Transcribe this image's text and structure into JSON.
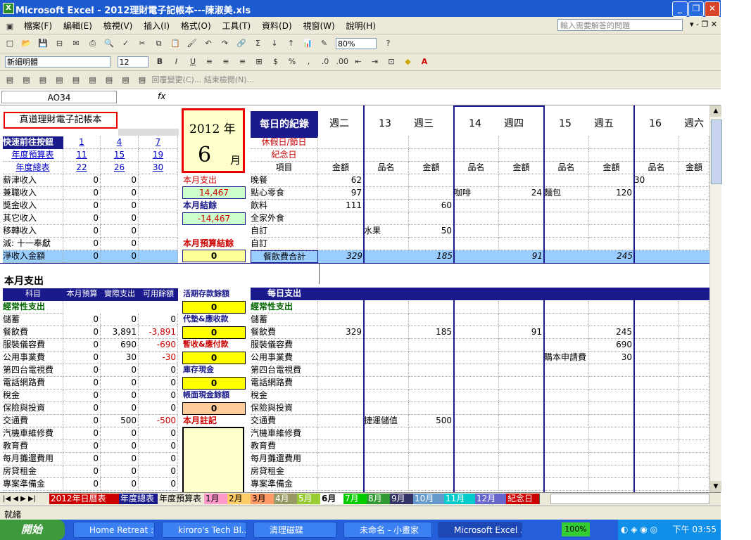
{
  "window": {
    "title": "Microsoft Excel - 2012理財電子記帳本---陳淑美.xls"
  },
  "menu": [
    "檔案(F)",
    "編輯(E)",
    "檢視(V)",
    "插入(I)",
    "格式(O)",
    "工具(T)",
    "資料(D)",
    "視窗(W)",
    "說明(H)"
  ],
  "help_placeholder": "輸入需要解答的問題",
  "toolbar": {
    "zoom": "80%",
    "font": "新細明體",
    "size": "12",
    "review": "回覆變更(C)... 結束檢閱(N)..."
  },
  "formula": {
    "cell": "AO34",
    "fx": "fx"
  },
  "sheet": {
    "book_title": "真道理財電子記帳本",
    "year": "2012 年",
    "month": "6",
    "month_label": "月",
    "quick_nav": "快速前往按鈕",
    "nav_rows": [
      {
        "label": "年度預算表",
        "a": "11",
        "b": "15",
        "c": "19"
      },
      {
        "label": "年度總表",
        "a": "22",
        "b": "26",
        "c": "30"
      }
    ],
    "nav_top": [
      "1",
      "4",
      "7"
    ],
    "income": [
      {
        "label": "薪津收入",
        "a": "0",
        "b": "0"
      },
      {
        "label": "兼職收入",
        "a": "0",
        "b": "0"
      },
      {
        "label": "獎金收入",
        "a": "0",
        "b": "0"
      },
      {
        "label": "其它收入",
        "a": "0",
        "b": "0"
      },
      {
        "label": "移轉收入",
        "a": "0",
        "b": "0"
      },
      {
        "label": "減: 十一奉獻",
        "a": "0",
        "b": "0"
      },
      {
        "label": "淨收入金額",
        "a": "0",
        "b": "0"
      }
    ],
    "month_expense_label": "本月支出",
    "month_expense_val": "14,467",
    "month_balance_label": "本月結餘",
    "month_balance_val": "-14,467",
    "budget_balance_label": "本月預算結餘",
    "budget_balance_val": "0",
    "daily_record": "每日的紀錄",
    "holiday": "休假日/節日",
    "memorial": "紀念日",
    "item": "項目",
    "days": [
      {
        "num": "",
        "name": "週二"
      },
      {
        "num": "13",
        "name": "週三"
      },
      {
        "num": "14",
        "name": "週四"
      },
      {
        "num": "15",
        "name": "週五"
      },
      {
        "num": "16",
        "name": "週六"
      }
    ],
    "col_name": "品名",
    "col_amt": "金額",
    "meal_rows": [
      "晚餐",
      "點心零食",
      "飲料",
      "全家外食",
      "自訂",
      "自訂"
    ],
    "meal_total": "餐飲費合計",
    "meal_vals": [
      [
        "62",
        "",
        "",
        "",
        "",
        "",
        "",
        "30",
        "",
        ""
      ],
      [
        "97",
        "",
        "",
        "咖啡",
        "24",
        "麵包",
        "120",
        "",
        "",
        ""
      ],
      [
        "111",
        "",
        "60",
        "",
        "",
        "",
        "",
        "",
        "",
        ""
      ],
      [
        "",
        "",
        "",
        "",
        "",
        "",
        "",
        "",
        "",
        ""
      ],
      [
        "",
        "水果",
        "50",
        "",
        "",
        "",
        "",
        "",
        "",
        ""
      ],
      [
        "",
        "",
        "",
        "",
        "",
        "",
        "",
        "",
        "",
        ""
      ]
    ],
    "meal_totals": [
      "329",
      "",
      "185",
      "",
      "91",
      "",
      "245",
      "",
      ""
    ],
    "section_title": "本月支出",
    "exp_headers": [
      "科目",
      "本月預算",
      "實際支出",
      "可用餘額"
    ],
    "exp_group": "經常性支出",
    "expenses": [
      {
        "label": "儲蓄",
        "b": "0",
        "a": "0",
        "r": "0"
      },
      {
        "label": "餐飲費",
        "b": "0",
        "a": "3,891",
        "r": "-3,891"
      },
      {
        "label": "服裝儀容費",
        "b": "0",
        "a": "690",
        "r": "-690"
      },
      {
        "label": "公用事業費",
        "b": "0",
        "a": "30",
        "r": "-30"
      },
      {
        "label": "第四台電視費",
        "b": "0",
        "a": "0",
        "r": "0"
      },
      {
        "label": "電話網路費",
        "b": "0",
        "a": "0",
        "r": "0"
      },
      {
        "label": "稅金",
        "b": "0",
        "a": "0",
        "r": "0"
      },
      {
        "label": "保險與投資",
        "b": "0",
        "a": "0",
        "r": "0"
      },
      {
        "label": "交通費",
        "b": "0",
        "a": "500",
        "r": "-500"
      },
      {
        "label": "汽機車維修費",
        "b": "0",
        "a": "0",
        "r": "0"
      },
      {
        "label": "教育費",
        "b": "0",
        "a": "0",
        "r": "0"
      },
      {
        "label": "每月攤還費用",
        "b": "0",
        "a": "0",
        "r": "0"
      },
      {
        "label": "房貸租金",
        "b": "0",
        "a": "0",
        "r": "0"
      },
      {
        "label": "專案準備金",
        "b": "0",
        "a": "0",
        "r": "0"
      }
    ],
    "mid_labels": [
      {
        "label": "活期存款餘額",
        "val": "0"
      },
      {
        "label": "代墊&應收款",
        "val": "0"
      },
      {
        "label": "暫收&應付款",
        "val": "0"
      },
      {
        "label": "庫存現金",
        "val": "0"
      },
      {
        "label": "帳面現金餘額",
        "val": "0"
      }
    ],
    "notes_label": "本月註記",
    "daily_exp": "每日支出",
    "daily_cells": {
      "food": [
        "329",
        "185",
        "91",
        "245"
      ],
      "clothes": "690",
      "utility_name": "購本申請費",
      "utility": "30",
      "transport_name": "捷運儲值",
      "transport": "500"
    }
  },
  "tabs": [
    "2012年日曆表",
    "年度總表",
    "年度預算表",
    "1月",
    "2月",
    "3月",
    "4月",
    "5月",
    "6月",
    "7月",
    "8月",
    "9月",
    "10月",
    "11月",
    "12月",
    "紀念日"
  ],
  "status": "就緒",
  "taskbar": {
    "start": "開始",
    "items": [
      "Home Retreat ::...",
      "kiroro's Tech Bl...",
      "清理磁碟",
      "未命名 - 小畫家",
      "Microsoft Excel ..."
    ],
    "clock": "下午 03:55",
    "tray_pct": "100%"
  }
}
